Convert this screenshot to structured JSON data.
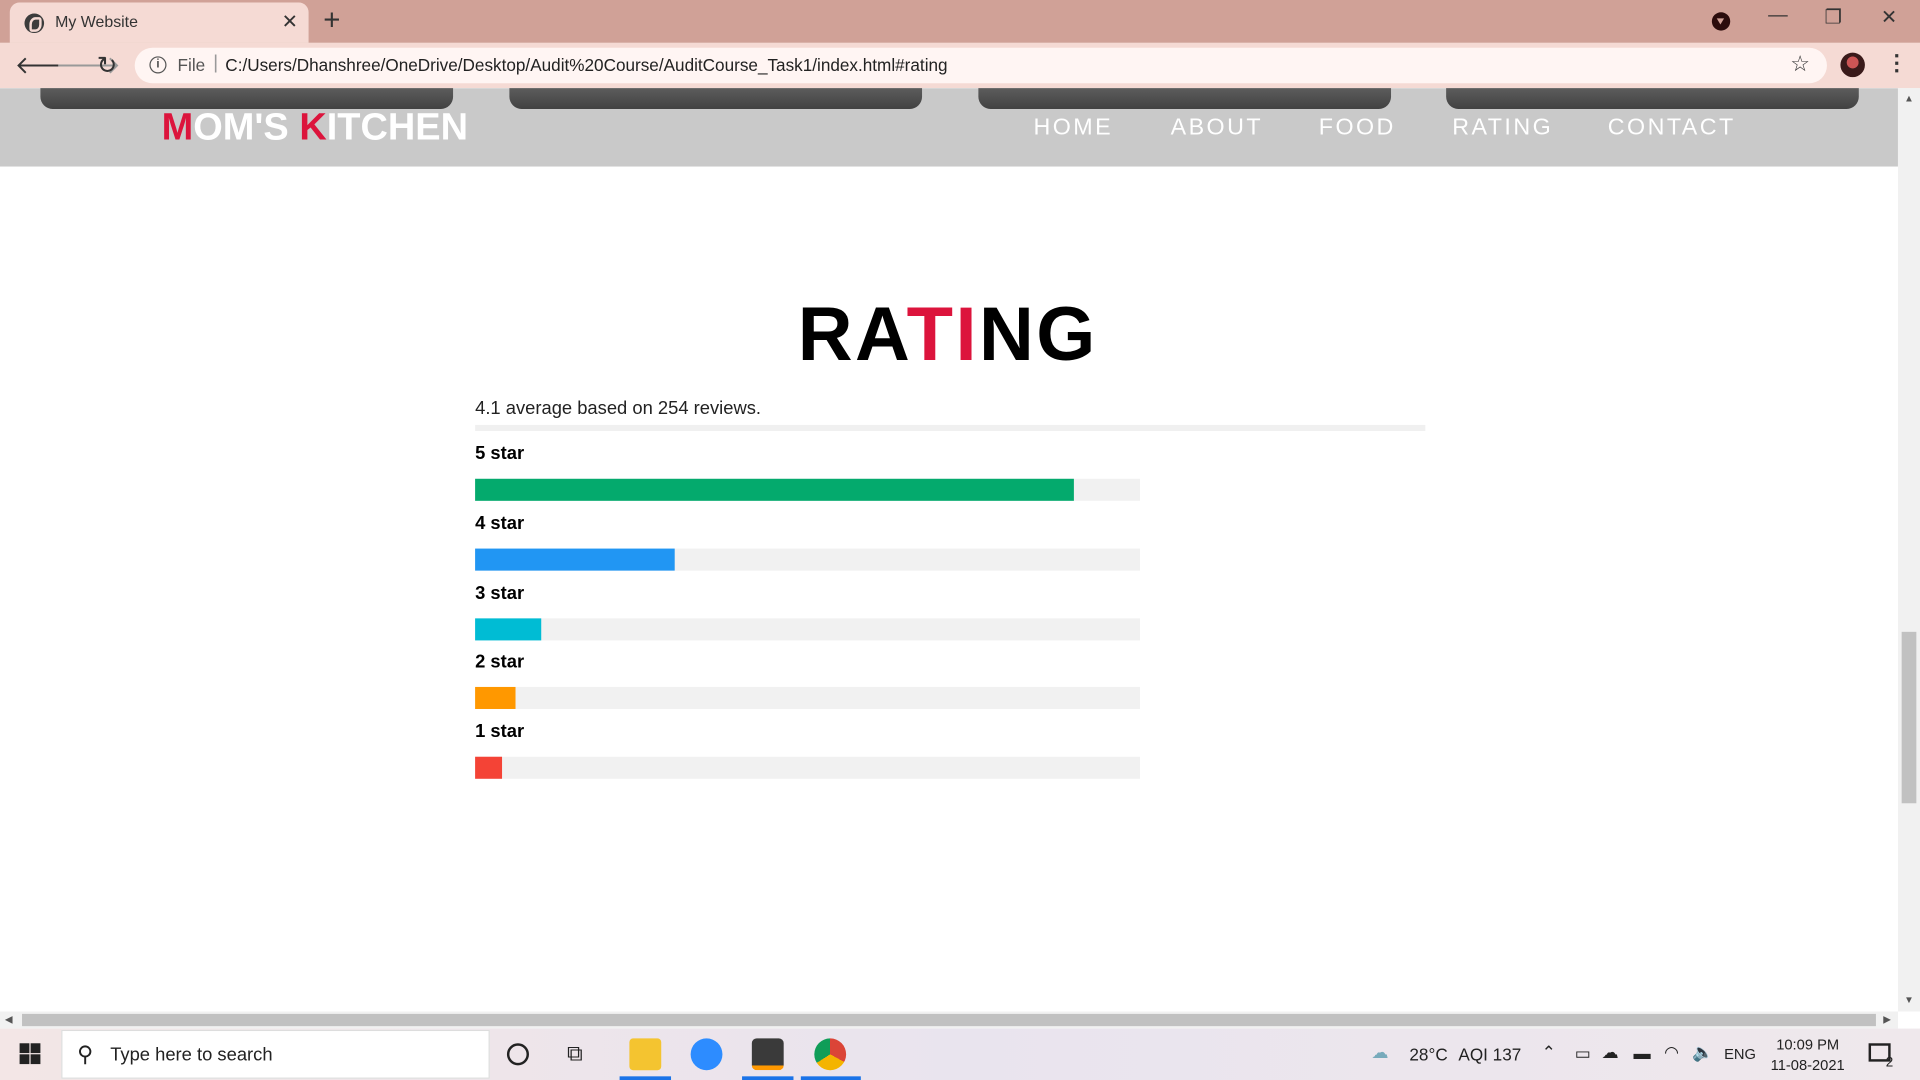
{
  "browser": {
    "tab_title": "My Website",
    "tab_close": "✕",
    "new_tab": "+",
    "omnibox_scheme": "File",
    "omnibox_url": "C:/Users/Dhanshree/OneDrive/Desktop/Audit%20Course/AuditCourse_Task1/index.html#rating",
    "window_controls": [
      "—",
      "❐",
      "✕"
    ]
  },
  "site": {
    "logo_parts": [
      {
        "text": "M",
        "accent": true
      },
      {
        "text": "OM'S ",
        "accent": false
      },
      {
        "text": "K",
        "accent": true
      },
      {
        "text": "ITCHEN",
        "accent": false
      }
    ],
    "nav": [
      "HOME",
      "ABOUT",
      "FOOD",
      "RATING",
      "CONTACT"
    ],
    "accent_color": "#dc143c"
  },
  "rating": {
    "title_parts": [
      {
        "text": "RA",
        "accent": false
      },
      {
        "text": "T",
        "accent": true
      },
      {
        "text": "I",
        "accent": true
      },
      {
        "text": "NG",
        "accent": false
      }
    ],
    "average_text": "4.1 average based on 254 reviews.",
    "bars": [
      {
        "label": "5 star",
        "fraction": 0.9,
        "color": "#04aa6d"
      },
      {
        "label": "4 star",
        "fraction": 0.3,
        "color": "#2196f3"
      },
      {
        "label": "3 star",
        "fraction": 0.1,
        "color": "#00bcd4"
      },
      {
        "label": "2 star",
        "fraction": 0.06,
        "color": "#ff9800"
      },
      {
        "label": "1 star",
        "fraction": 0.04,
        "color": "#f44336"
      }
    ]
  },
  "taskbar": {
    "search_placeholder": "Type here to search",
    "weather": "28°C",
    "aqi": "AQI 137",
    "language": "ENG",
    "time": "10:09 PM",
    "date": "11-08-2021",
    "notification_count": "2"
  }
}
